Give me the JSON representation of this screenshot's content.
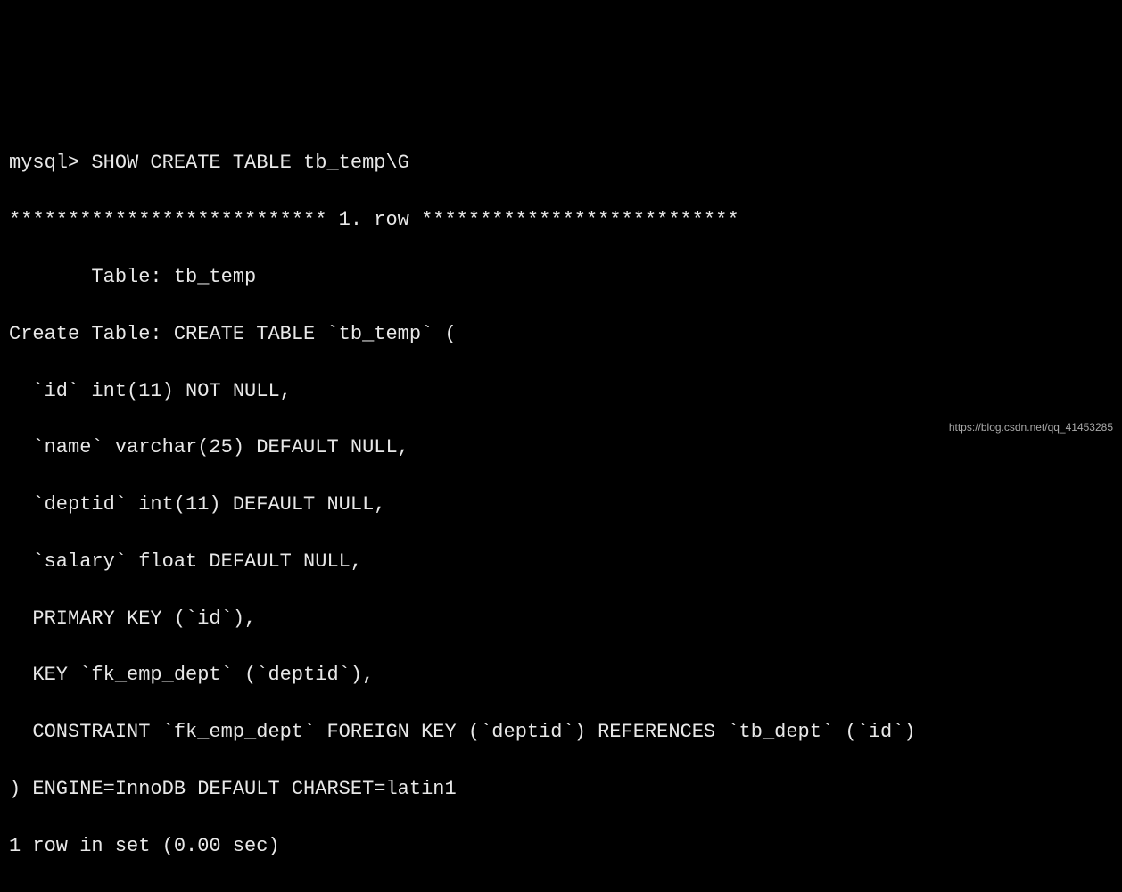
{
  "terminal": {
    "lines": [
      "mysql> SHOW CREATE TABLE tb_temp\\G",
      "*************************** 1. row ***************************",
      "       Table: tb_temp",
      "Create Table: CREATE TABLE `tb_temp` (",
      "  `id` int(11) NOT NULL,",
      "  `name` varchar(25) DEFAULT NULL,",
      "  `deptid` int(11) DEFAULT NULL,",
      "  `salary` float DEFAULT NULL,",
      "  PRIMARY KEY (`id`),",
      "  KEY `fk_emp_dept` (`deptid`),",
      "  CONSTRAINT `fk_emp_dept` FOREIGN KEY (`deptid`) REFERENCES `tb_dept` (`id`)",
      ") ENGINE=InnoDB DEFAULT CHARSET=latin1",
      "1 row in set (0.00 sec)"
    ]
  },
  "watermark": "https://blog.csdn.net/qq_41453285"
}
